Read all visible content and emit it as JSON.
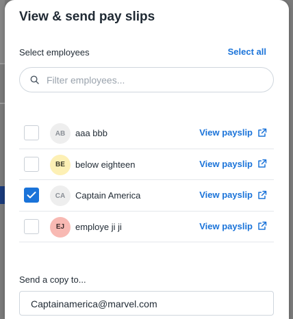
{
  "modal": {
    "title": "View & send pay slips"
  },
  "employees_section": {
    "label": "Select employees",
    "select_all_label": "Select all",
    "filter_placeholder": "Filter employees..."
  },
  "employees": [
    {
      "initials": "AB",
      "name": "aaa bbb",
      "checked": false,
      "avatar_bg": "#eeeeee",
      "avatar_fg": "#8a8f96",
      "action_label": "View payslip"
    },
    {
      "initials": "BE",
      "name": "below eighteen",
      "checked": false,
      "avatar_bg": "#fdf0b5",
      "avatar_fg": "#3a3a2a",
      "action_label": "View payslip"
    },
    {
      "initials": "CA",
      "name": "Captain America",
      "checked": true,
      "avatar_bg": "#eeeeee",
      "avatar_fg": "#8a8f96",
      "action_label": "View payslip"
    },
    {
      "initials": "EJ",
      "name": "employe ji ji",
      "checked": false,
      "avatar_bg": "#f8b9b3",
      "avatar_fg": "#3a2a2a",
      "action_label": "View payslip"
    }
  ],
  "copy_section": {
    "label": "Send a copy to...",
    "email_value": "Captainamerica@marvel.com"
  },
  "colors": {
    "accent": "#1a73d9",
    "text": "#1f2933",
    "border": "#cfd6dd"
  },
  "icons": {
    "search": "search-icon",
    "external_link": "external-link-icon",
    "check": "checkmark-icon"
  }
}
